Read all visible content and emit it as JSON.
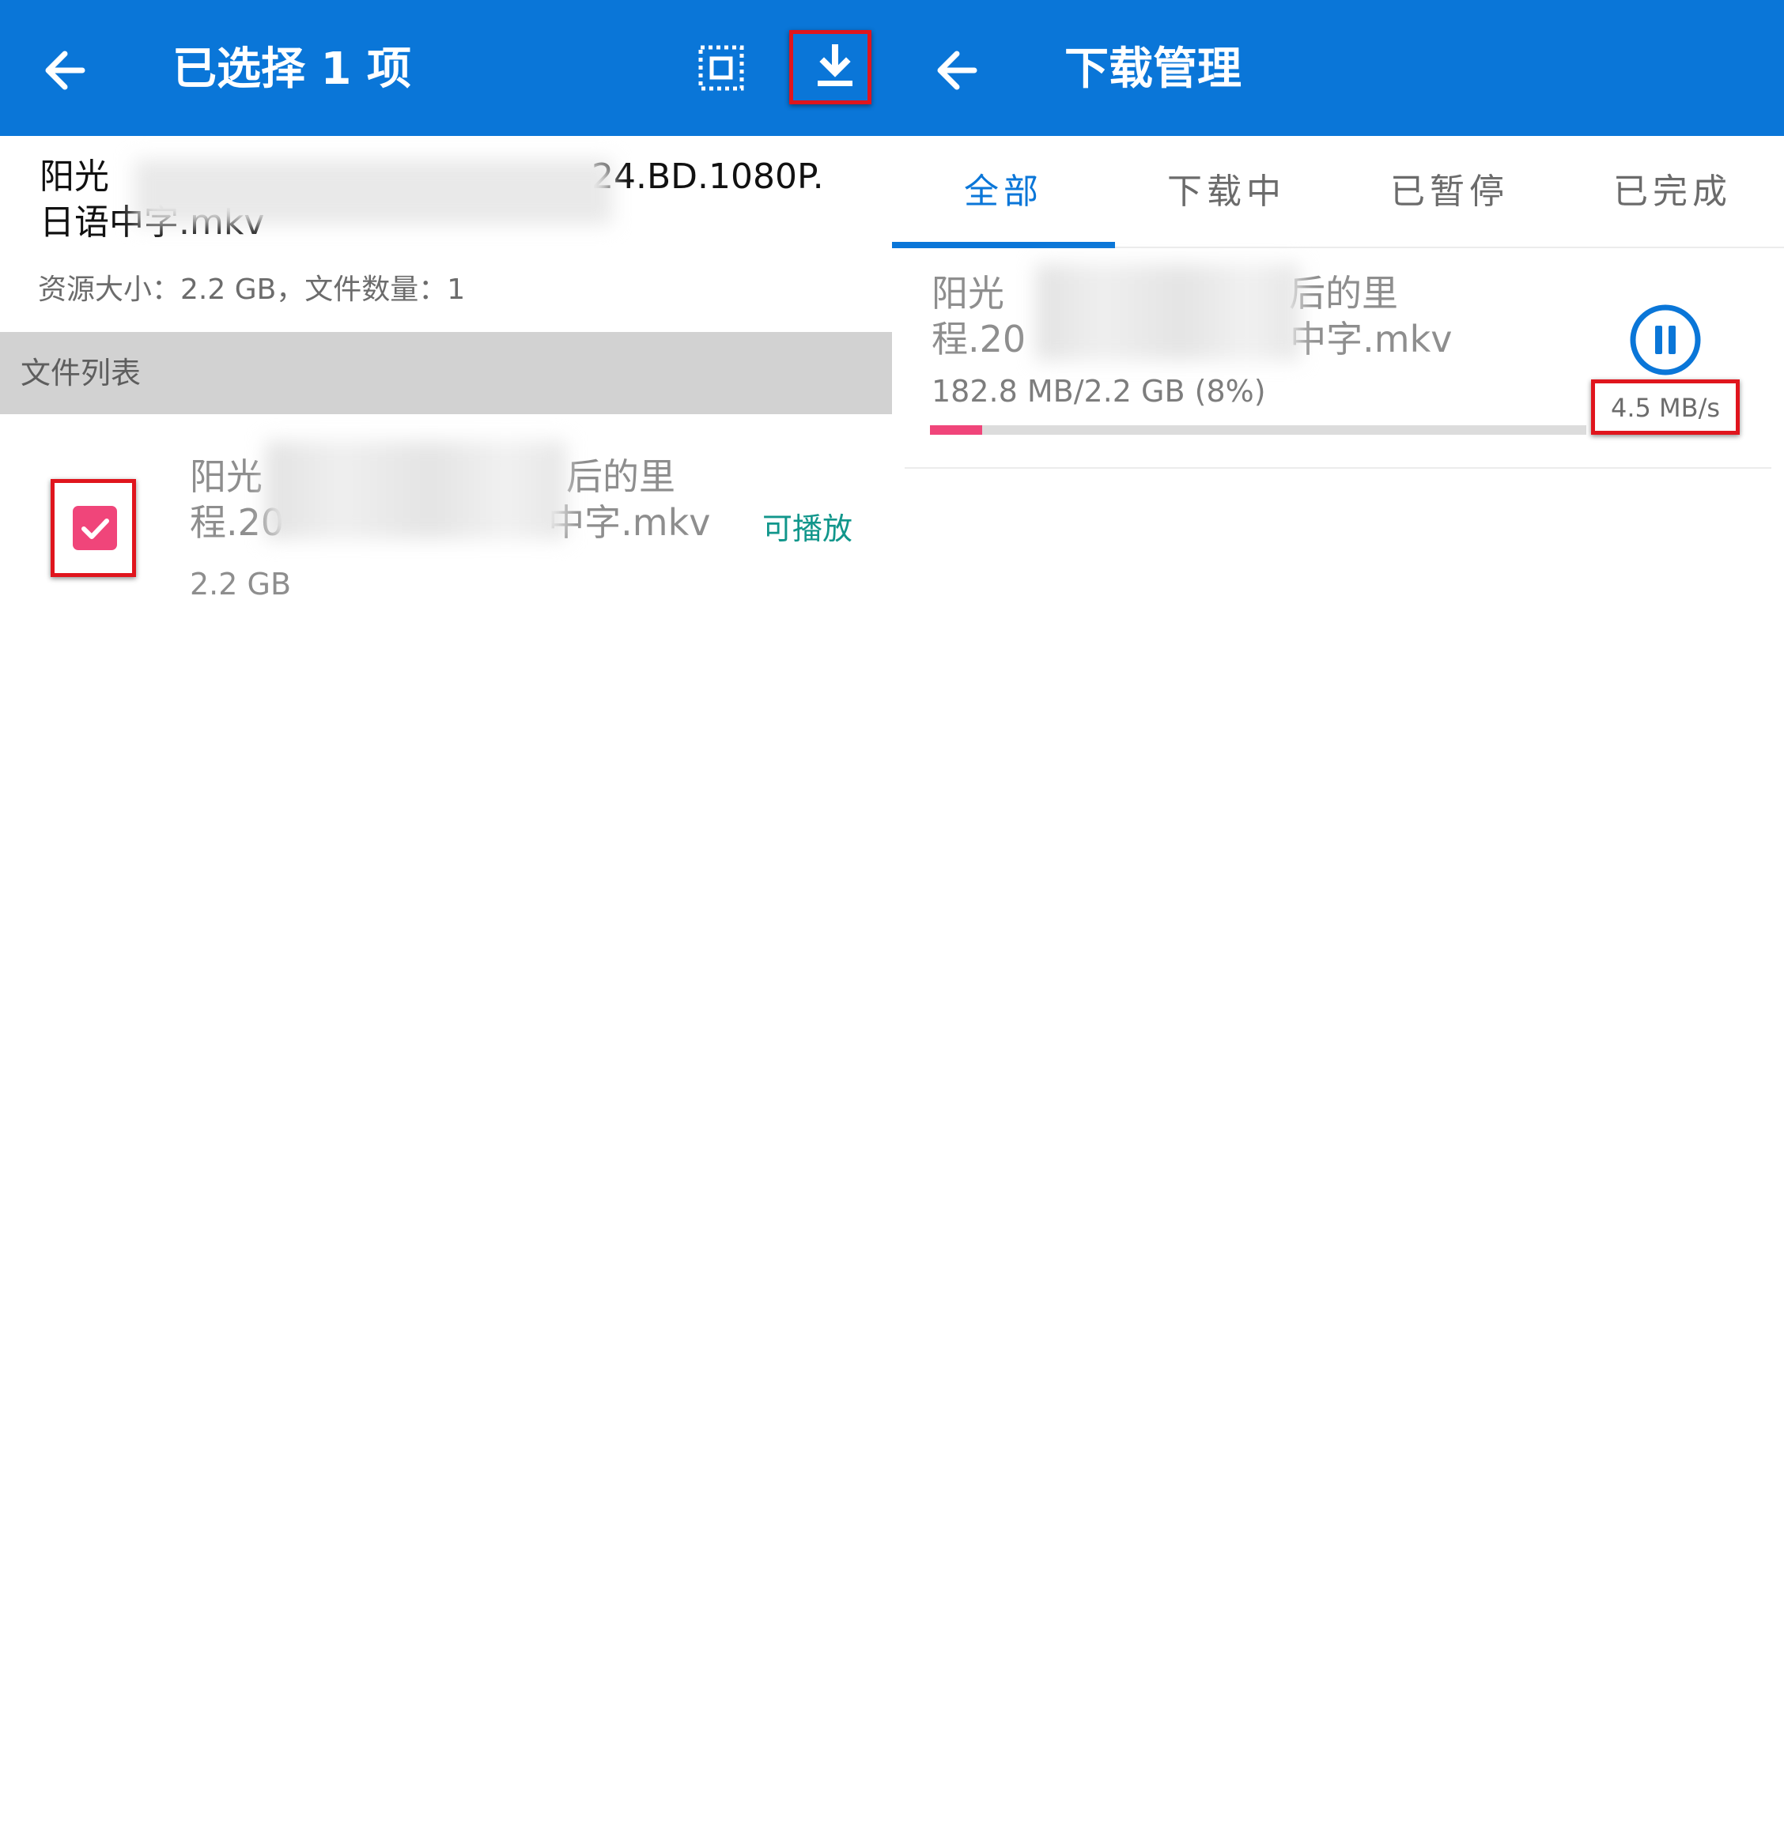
{
  "colors": {
    "appbar": "#0a76d8",
    "accent_pink": "#f0457a",
    "playable_green": "#11968b",
    "highlight_red": "#e0151d"
  },
  "left": {
    "appbar": {
      "back_icon": "arrow-left-icon",
      "title": "已选择 1 项",
      "select_all_icon": "select-all-icon",
      "download_icon": "download-icon"
    },
    "resource": {
      "name_line1_start": "阳光",
      "name_line1_end": "24.BD.1080P.",
      "name_line2": "日语中字.mkv",
      "meta": "资源大小：2.2 GB，文件数量：1"
    },
    "section_label": "文件列表",
    "files": [
      {
        "checked": true,
        "name_line1_start": "阳光",
        "name_line1_end": "后的里",
        "name_line2_start": "程.20",
        "name_line2_end": "中字.mkv",
        "tag": "可播放",
        "size": "2.2 GB"
      }
    ]
  },
  "right": {
    "appbar": {
      "back_icon": "arrow-left-icon",
      "title": "下载管理"
    },
    "tabs": [
      {
        "label": "全部",
        "active": true
      },
      {
        "label": "下载中",
        "active": false
      },
      {
        "label": "已暂停",
        "active": false
      },
      {
        "label": "已完成",
        "active": false
      }
    ],
    "downloads": [
      {
        "name_line1_start": "阳光",
        "name_line1_end": "后的里",
        "name_line2_start": "程.20",
        "name_line2_end": "中字.mkv",
        "progress_text": "182.8 MB/2.2 GB (8%)",
        "progress": 0.08,
        "action_icon": "pause-icon",
        "speed": "4.5 MB/s"
      }
    ]
  }
}
